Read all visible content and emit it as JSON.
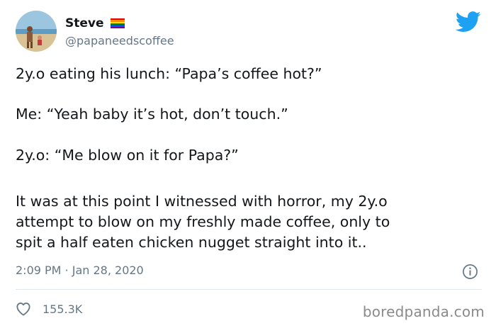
{
  "tweet": {
    "author": {
      "display_name": "Steve",
      "handle": "@papaneedscoffee",
      "avatar_icon": "profile-photo"
    },
    "flag_icon": "rainbow-flag-icon",
    "flag_colors": [
      "#e40303",
      "#ff8c00",
      "#ffed00",
      "#008026",
      "#004dff",
      "#750787"
    ],
    "brand_icon": "twitter-bird-icon",
    "brand_color": "#1da1f2",
    "text_lines": [
      "2y.o eating his lunch: “Papa’s coffee hot?”",
      "Me: “Yeah baby it’s hot, don’t touch.”",
      "2y.o: “Me blow on it for Papa?”",
      "It was at this point I witnessed with horror, my 2y.o",
      "attempt to blow on my freshly made coffee, only to",
      "spit a half eaten chicken nugget straight into it.."
    ],
    "timestamp": "2:09 PM · Jan 28, 2020",
    "info_icon": "info-icon",
    "like_icon": "heart-icon",
    "like_count": "155.3K"
  },
  "watermark": "boredpanda.com"
}
